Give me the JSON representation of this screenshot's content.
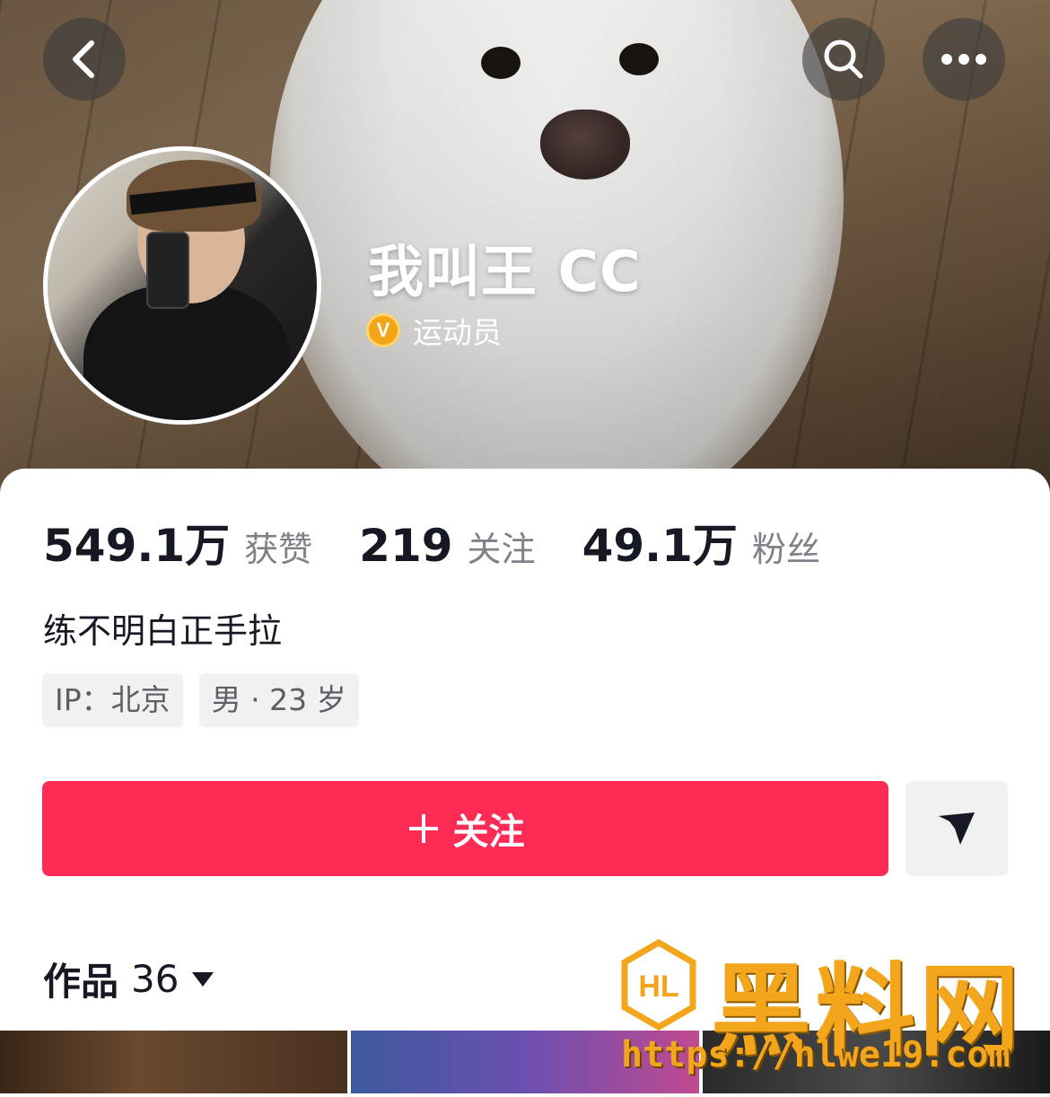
{
  "header": {
    "back_icon": "chevron-left-icon",
    "search_icon": "search-icon",
    "more_icon": "more-dots-icon"
  },
  "profile": {
    "name": "我叫王 CC",
    "verified_badge": "V",
    "verified_title": "运动员",
    "bio": "练不明白正手拉",
    "tags": [
      "IP：北京",
      "男 · 23 岁"
    ]
  },
  "stats": [
    {
      "value": "549.1万",
      "label": "获赞"
    },
    {
      "value": "219",
      "label": "关注"
    },
    {
      "value": "49.1万",
      "label": "粉丝"
    }
  ],
  "actions": {
    "follow_label": "关注",
    "follow_icon": "plus-icon",
    "share_icon": "send-icon"
  },
  "works": {
    "label": "作品",
    "count": "36",
    "dropdown_icon": "caret-down-icon"
  },
  "watermark": {
    "logo_text": "HL",
    "text": "黑料网",
    "url": "https://hlwe19.com"
  },
  "colors": {
    "follow_button": "#fe2c55",
    "verified_badge": "#f2a516",
    "watermark": "#f3a51b"
  }
}
